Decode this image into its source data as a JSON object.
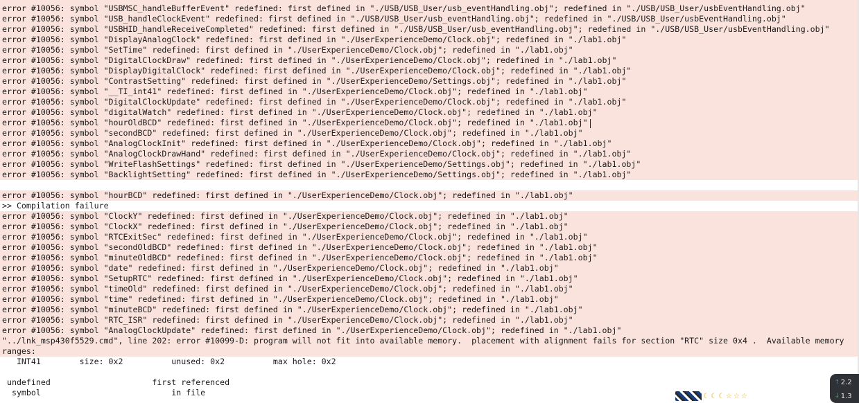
{
  "console": {
    "errors_block_1": [
      "error #10056: symbol \"USBMSC_handleBufferEvent\" redefined: first defined in \"./USB/USB_User/usb_eventHandling.obj\"; redefined in \"./USB/USB_User/usbEventHandling.obj\"",
      "error #10056: symbol \"USB_handleClockEvent\" redefined: first defined in \"./USB/USB_User/usb_eventHandling.obj\"; redefined in \"./USB/USB_User/usbEventHandling.obj\"",
      "error #10056: symbol \"USBHID_handleReceiveCompleted\" redefined: first defined in \"./USB/USB_User/usb_eventHandling.obj\"; redefined in \"./USB/USB_User/usbEventHandling.obj\"",
      "error #10056: symbol \"DisplayAnalogClock\" redefined: first defined in \"./UserExperienceDemo/Clock.obj\"; redefined in \"./lab1.obj\"",
      "error #10056: symbol \"SetTime\" redefined: first defined in \"./UserExperienceDemo/Clock.obj\"; redefined in \"./lab1.obj\"",
      "error #10056: symbol \"DigitalClockDraw\" redefined: first defined in \"./UserExperienceDemo/Clock.obj\"; redefined in \"./lab1.obj\"",
      "error #10056: symbol \"DisplayDigitalClock\" redefined: first defined in \"./UserExperienceDemo/Clock.obj\"; redefined in \"./lab1.obj\"",
      "error #10056: symbol \"ContrastSetting\" redefined: first defined in \"./UserExperienceDemo/Settings.obj\"; redefined in \"./lab1.obj\"",
      "error #10056: symbol \"__TI_int41\" redefined: first defined in \"./UserExperienceDemo/Clock.obj\"; redefined in \"./lab1.obj\"",
      "error #10056: symbol \"DigitalClockUpdate\" redefined: first defined in \"./UserExperienceDemo/Clock.obj\"; redefined in \"./lab1.obj\"",
      "error #10056: symbol \"digitalWatch\" redefined: first defined in \"./UserExperienceDemo/Clock.obj\"; redefined in \"./lab1.obj\"",
      "error #10056: symbol \"hourOldBCD\" redefined: first defined in \"./UserExperienceDemo/Clock.obj\"; redefined in \"./lab1.obj\"",
      "error #10056: symbol \"secondBCD\" redefined: first defined in \"./UserExperienceDemo/Clock.obj\"; redefined in \"./lab1.obj\"",
      "error #10056: symbol \"AnalogClockInit\" redefined: first defined in \"./UserExperienceDemo/Clock.obj\"; redefined in \"./lab1.obj\"",
      "error #10056: symbol \"AnalogClockDrawHand\" redefined: first defined in \"./UserExperienceDemo/Clock.obj\"; redefined in \"./lab1.obj\"",
      "error #10056: symbol \"WriteFlashSettings\" redefined: first defined in \"./UserExperienceDemo/Settings.obj\"; redefined in \"./lab1.obj\"",
      "error #10056: symbol \"BacklightSetting\" redefined: first defined in \"./UserExperienceDemo/Settings.obj\"; redefined in \"./lab1.obj\""
    ],
    "error_hourBCD": "error #10056: symbol \"hourBCD\" redefined: first defined in \"./UserExperienceDemo/Clock.obj\"; redefined in \"./lab1.obj\"",
    "compilation_failure": ">> Compilation failure",
    "errors_block_2": [
      "error #10056: symbol \"ClockY\" redefined: first defined in \"./UserExperienceDemo/Clock.obj\"; redefined in \"./lab1.obj\"",
      "error #10056: symbol \"ClockX\" redefined: first defined in \"./UserExperienceDemo/Clock.obj\"; redefined in \"./lab1.obj\"",
      "error #10056: symbol \"RTCExitSec\" redefined: first defined in \"./UserExperienceDemo/Clock.obj\"; redefined in \"./lab1.obj\"",
      "error #10056: symbol \"secondOldBCD\" redefined: first defined in \"./UserExperienceDemo/Clock.obj\"; redefined in \"./lab1.obj\"",
      "error #10056: symbol \"minuteOldBCD\" redefined: first defined in \"./UserExperienceDemo/Clock.obj\"; redefined in \"./lab1.obj\"",
      "error #10056: symbol \"date\" redefined: first defined in \"./UserExperienceDemo/Clock.obj\"; redefined in \"./lab1.obj\"",
      "error #10056: symbol \"SetupRTC\" redefined: first defined in \"./UserExperienceDemo/Clock.obj\"; redefined in \"./lab1.obj\"",
      "error #10056: symbol \"timeOld\" redefined: first defined in \"./UserExperienceDemo/Clock.obj\"; redefined in \"./lab1.obj\"",
      "error #10056: symbol \"time\" redefined: first defined in \"./UserExperienceDemo/Clock.obj\"; redefined in \"./lab1.obj\"",
      "error #10056: symbol \"minuteBCD\" redefined: first defined in \"./UserExperienceDemo/Clock.obj\"; redefined in \"./lab1.obj\"",
      "error #10056: symbol \"RTC_ISR\" redefined: first defined in \"./UserExperienceDemo/Clock.obj\"; redefined in \"./lab1.obj\"",
      "error #10056: symbol \"AnalogClockUpdate\" redefined: first defined in \"./UserExperienceDemo/Clock.obj\"; redefined in \"./lab1.obj\""
    ],
    "memory_error_line1": "\"../lnk_msp430f5529.cmd\", line 202: error #10099-D: program will not fit into available memory.  placement with alignment fails for section \"RTC\" size 0x4 .  Available memory",
    "memory_error_line2": "ranges:",
    "memory_range": "   INT41        size: 0x2          unused: 0x2          max hole: 0x2",
    "undefined_header_1": " undefined                     first referenced",
    "undefined_header_2": "  symbol                           in file"
  },
  "tray": {
    "moons": [
      "☾",
      "☾",
      "☾"
    ],
    "stars": [
      "☆",
      "☆",
      "☆"
    ]
  },
  "network": {
    "upload": "2.2",
    "download": "1.3",
    "up_arrow": "🡑",
    "down_arrow": "🡓"
  }
}
